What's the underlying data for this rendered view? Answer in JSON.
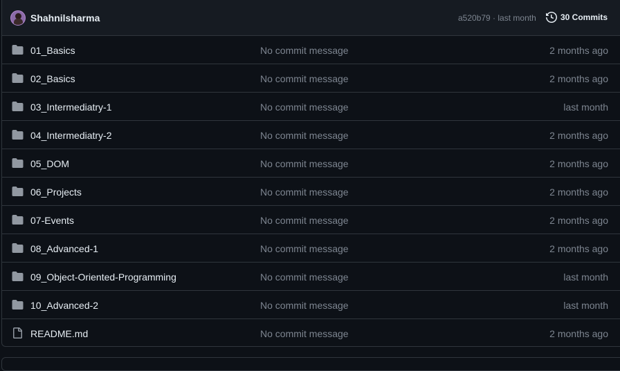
{
  "header": {
    "username": "Shahnilsharma",
    "commit_hash": "a520b79",
    "commit_separator": " · ",
    "commit_time": "last month",
    "commits_count_label": "30 Commits"
  },
  "files": [
    {
      "name": "01_Basics",
      "type": "folder",
      "message": "No commit message",
      "date": "2 months ago"
    },
    {
      "name": "02_Basics",
      "type": "folder",
      "message": "No commit message",
      "date": "2 months ago"
    },
    {
      "name": "03_Intermediatry-1",
      "type": "folder",
      "message": "No commit message",
      "date": "last month"
    },
    {
      "name": "04_Intermediatry-2",
      "type": "folder",
      "message": "No commit message",
      "date": "2 months ago"
    },
    {
      "name": "05_DOM",
      "type": "folder",
      "message": "No commit message",
      "date": "2 months ago"
    },
    {
      "name": "06_Projects",
      "type": "folder",
      "message": "No commit message",
      "date": "2 months ago"
    },
    {
      "name": "07-Events",
      "type": "folder",
      "message": "No commit message",
      "date": "2 months ago"
    },
    {
      "name": "08_Advanced-1",
      "type": "folder",
      "message": "No commit message",
      "date": "2 months ago"
    },
    {
      "name": "09_Object-Oriented-Programming",
      "type": "folder",
      "message": "No commit message",
      "date": "last month"
    },
    {
      "name": "10_Advanced-2",
      "type": "folder",
      "message": "No commit message",
      "date": "last month"
    },
    {
      "name": "README.md",
      "type": "file",
      "message": "No commit message",
      "date": "2 months ago"
    }
  ],
  "icons": {
    "folder": "folder-icon",
    "file": "file-icon",
    "history": "history-icon"
  },
  "colors": {
    "background": "#0d1117",
    "header_background": "#161b22",
    "border": "#30363d",
    "text": "#e6edf3",
    "muted": "#7d8590",
    "folder_icon": "#9198a1"
  }
}
